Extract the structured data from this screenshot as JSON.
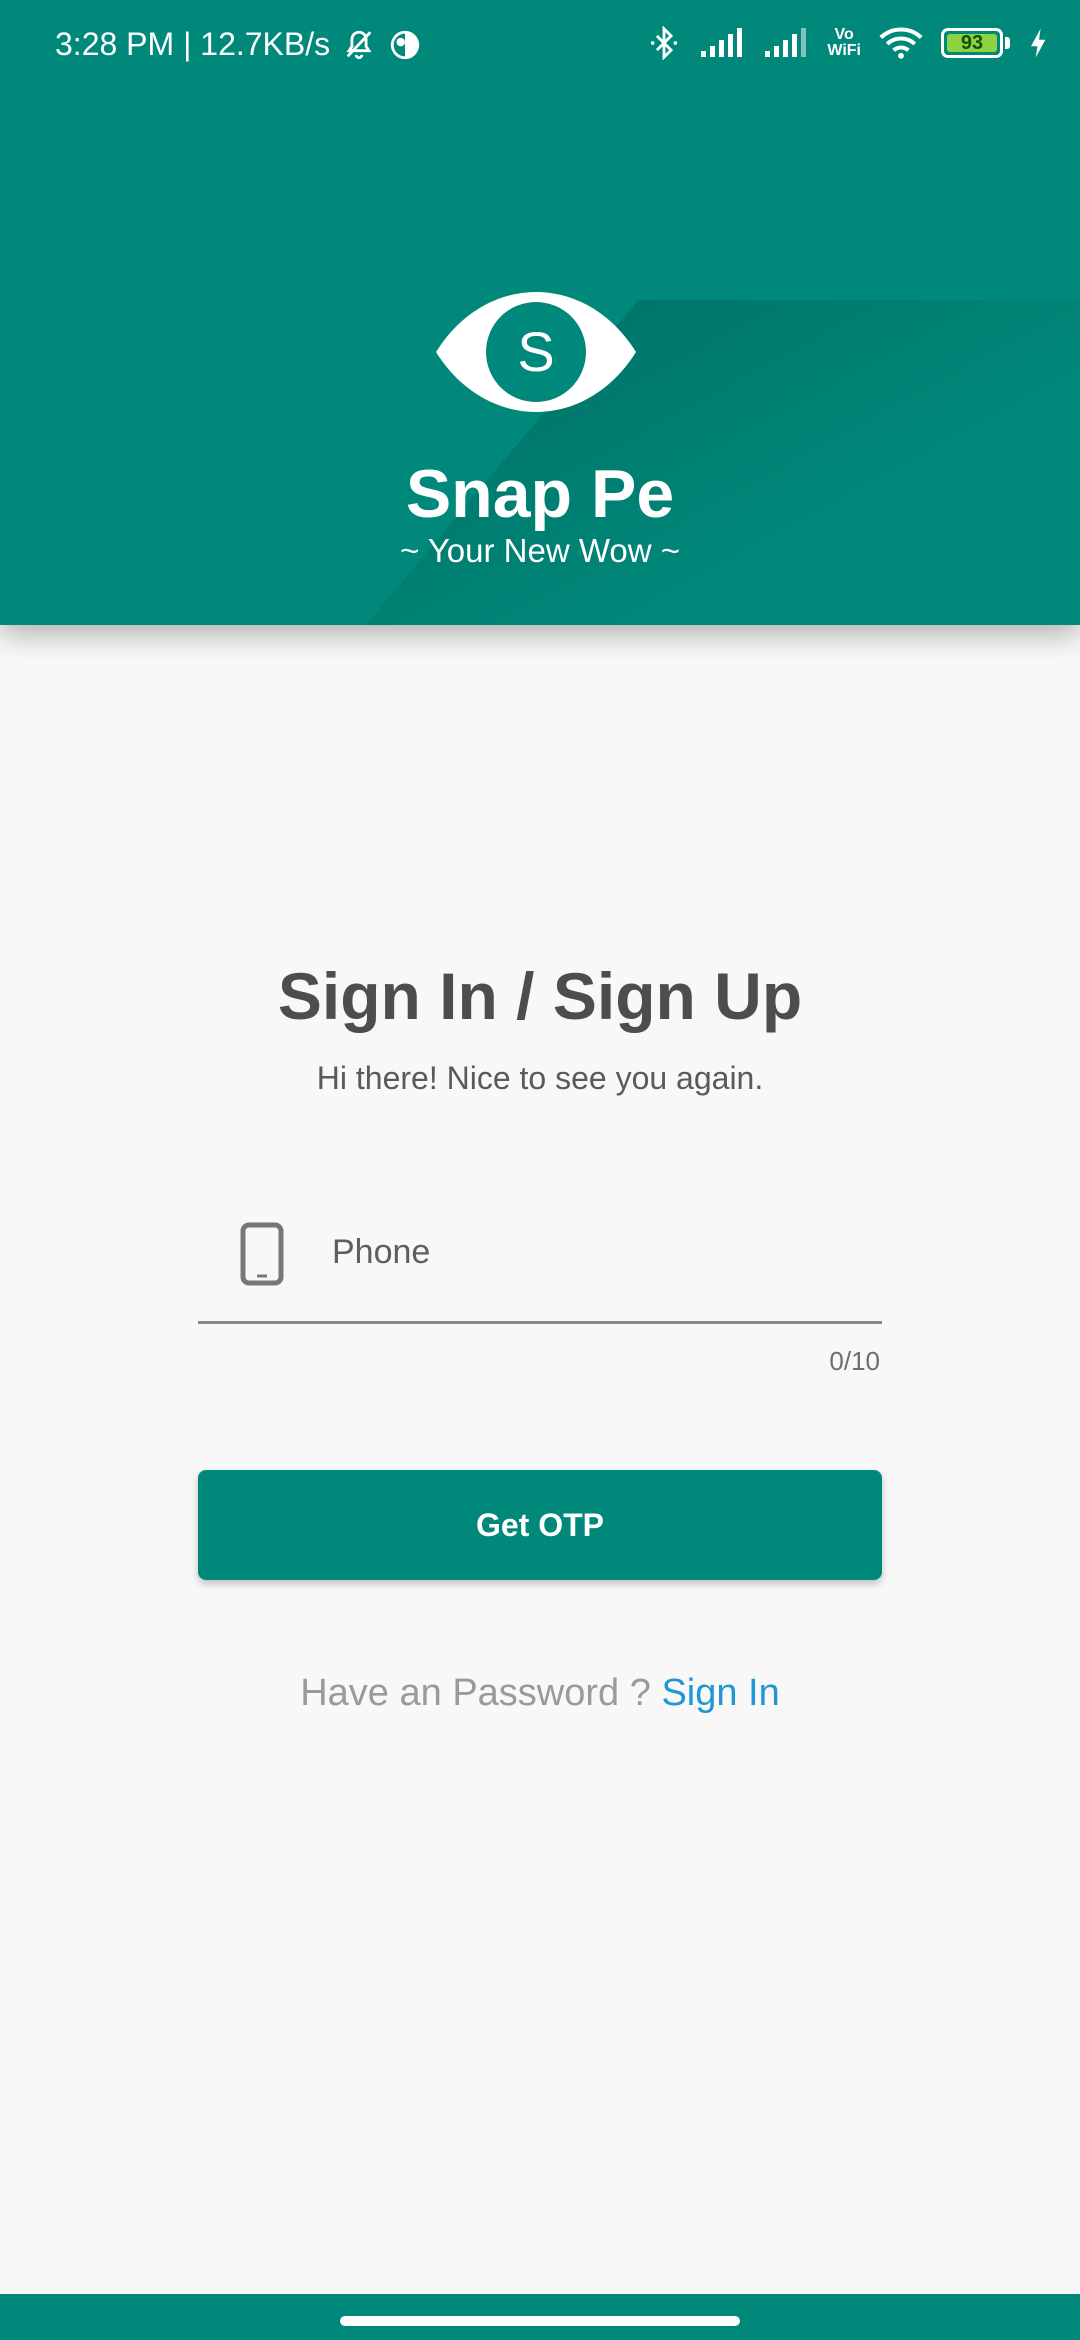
{
  "status_bar": {
    "time_speed": "3:28 PM | 12.7KB/s",
    "battery_level": "93",
    "wifi_label_top": "Vo",
    "wifi_label_bottom": "WiFi",
    "icons": [
      "mute-bell-icon",
      "app-indicator-icon",
      "bluetooth-icon",
      "signal-icon",
      "signal-icon",
      "vowifi-icon",
      "wifi-icon",
      "battery-icon",
      "charging-icon"
    ]
  },
  "header": {
    "app_name": "Snap Pe",
    "tagline": "~ Your New Wow ~",
    "logo_letter": "S",
    "colors": {
      "primary": "#00897b"
    }
  },
  "main": {
    "title": "Sign In / Sign Up",
    "subtitle": "Hi there! Nice to see you again.",
    "phone_field": {
      "placeholder": "Phone",
      "value": "",
      "counter": "0/10",
      "icon": "smartphone-icon"
    },
    "otp_button_label": "Get OTP",
    "password_prompt": "Have an Password ?",
    "signin_link": "Sign In",
    "colors": {
      "link": "#2196d3"
    }
  }
}
